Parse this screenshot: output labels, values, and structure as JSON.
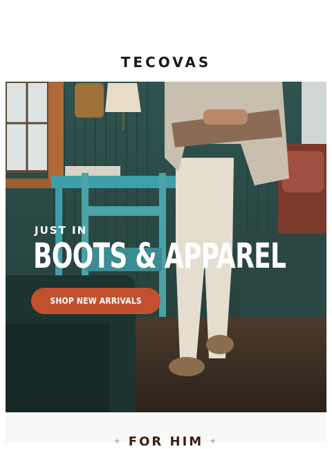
{
  "brand": {
    "logo_text": "TECOVAS"
  },
  "hero": {
    "eyebrow": "JUST IN",
    "headline": "BOOTS & APPAREL",
    "cta_label": "SHOP NEW ARRIVALS",
    "cta_color": "#c2502f"
  },
  "section": {
    "title": "FOR HIM",
    "left_icon": "sparkle-icon",
    "right_icon": "sparkle-icon"
  }
}
